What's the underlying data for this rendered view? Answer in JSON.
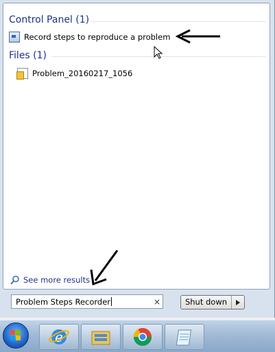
{
  "results": {
    "control_panel": {
      "header": "Control Panel (1)",
      "items": [
        {
          "label": "Record steps to reproduce a problem",
          "icon": "steps-recorder-icon"
        }
      ]
    },
    "files": {
      "header": "Files (1)",
      "items": [
        {
          "label": "Problem_20160217_1056",
          "icon": "zip-file-icon"
        }
      ]
    },
    "see_more": "See more results"
  },
  "search": {
    "value": "Problem Steps Recorder",
    "clear_label": "×"
  },
  "shutdown": {
    "label": "Shut down"
  },
  "taskbar": {
    "pinned": [
      "internet-explorer-icon",
      "windows-explorer-icon",
      "chrome-icon",
      "notepad-icon"
    ]
  },
  "colors": {
    "header_text": "#1e3287",
    "panel_bg": "#d8e2ee",
    "taskbar": "#9fb8d4"
  }
}
